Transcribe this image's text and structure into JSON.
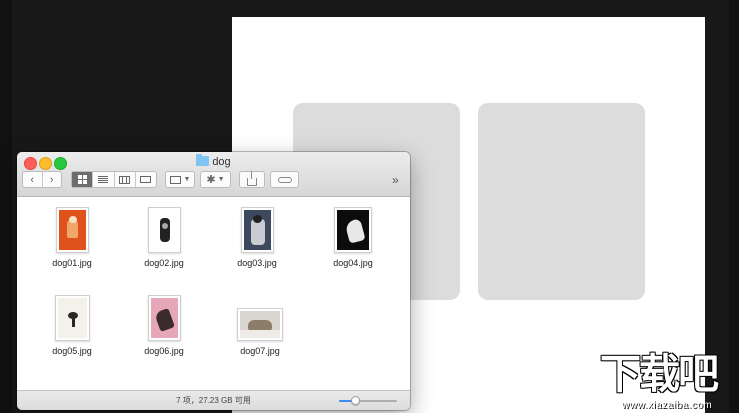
{
  "window": {
    "title": "dog",
    "nav": {
      "back_icon": "chevron-left-icon",
      "forward_icon": "chevron-right-icon"
    },
    "view_modes": [
      "icon-view",
      "list-view",
      "column-view",
      "cover-flow-view"
    ],
    "active_view": "icon-view",
    "toolbar_overflow": "»"
  },
  "files": [
    {
      "name": "dog01.jpg",
      "colors": [
        "#e0521c",
        "#f0a86a"
      ]
    },
    {
      "name": "dog02.jpg",
      "colors": [
        "#ffffff",
        "#222222"
      ]
    },
    {
      "name": "dog03.jpg",
      "colors": [
        "#3d4a5e",
        "#c9ccd3"
      ]
    },
    {
      "name": "dog04.jpg",
      "colors": [
        "#0c0c0c",
        "#e8e8e8"
      ]
    },
    {
      "name": "dog05.jpg",
      "colors": [
        "#f4f1ea",
        "#2a2622"
      ]
    },
    {
      "name": "dog06.jpg",
      "colors": [
        "#e6a8b8",
        "#3b2b2e"
      ]
    },
    {
      "name": "dog07.jpg",
      "colors": [
        "#d9d6d1",
        "#8c7d6b"
      ]
    }
  ],
  "status": {
    "text": "7 项，27.23 GB 可用",
    "zoom_level": 0.25
  },
  "watermark": {
    "logo_text": "下载吧",
    "url_text": "www.xiazaiba.com"
  }
}
